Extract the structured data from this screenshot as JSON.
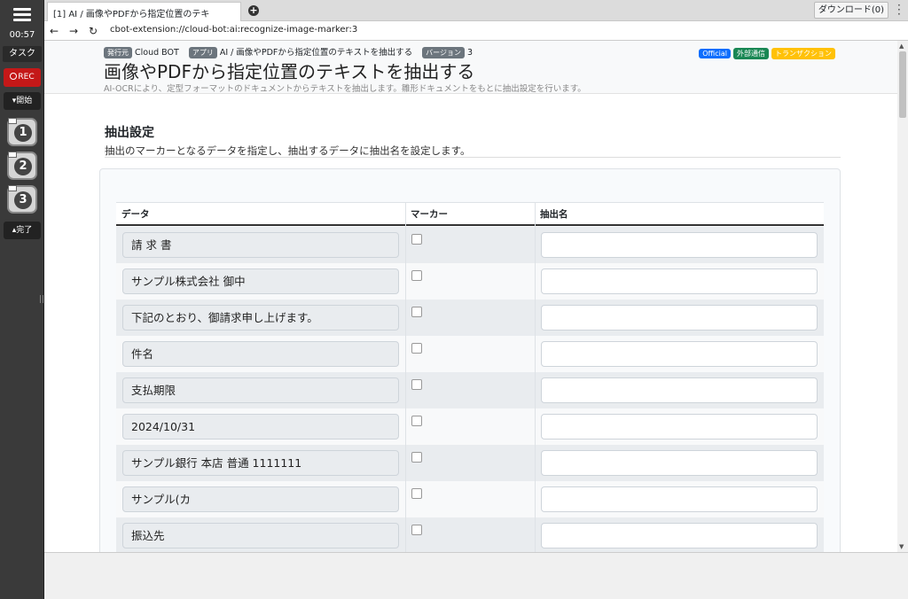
{
  "rail": {
    "timer": "00:57",
    "task_label": "タスク",
    "rec_label": "REC",
    "start_label": "開始",
    "steps": [
      "1",
      "2",
      "3"
    ],
    "done_label": "完了"
  },
  "browser": {
    "tab_title": "[1] AI / 画像やPDFから指定位置のテキ",
    "download_label": "ダウンロード(0)",
    "url": "cbot-extension://cloud-bot:ai:recognize-image-marker:3"
  },
  "header": {
    "publisher_label": "発行元",
    "publisher": "Cloud BOT",
    "app_label": "アプリ",
    "app": "AI / 画像やPDFから指定位置のテキストを抽出する",
    "version_label": "バージョン",
    "version": "3",
    "badges": [
      {
        "label": "Official",
        "color": "#0d6efd"
      },
      {
        "label": "外部通信",
        "color": "#198754"
      },
      {
        "label": "トランザクション",
        "color": "#ffc107"
      }
    ],
    "title": "画像やPDFから指定位置のテキストを抽出する",
    "subtitle": "AI-OCRにより、定型フォーマットのドキュメントからテキストを抽出します。雛形ドキュメントをもとに抽出設定を行います。"
  },
  "section": {
    "title": "抽出設定",
    "description": "抽出のマーカーとなるデータを指定し、抽出するデータに抽出名を設定します。"
  },
  "table": {
    "headers": {
      "data": "データ",
      "marker": "マーカー",
      "name": "抽出名"
    },
    "rows": [
      {
        "data": "請 求 書",
        "marker": false,
        "name": ""
      },
      {
        "data": "サンプル株式会社 御中",
        "marker": false,
        "name": ""
      },
      {
        "data": "下記のとおり、御請求申し上げます。",
        "marker": false,
        "name": ""
      },
      {
        "data": "件名",
        "marker": false,
        "name": ""
      },
      {
        "data": "支払期限",
        "marker": false,
        "name": ""
      },
      {
        "data": "2024/10/31",
        "marker": false,
        "name": ""
      },
      {
        "data": "サンプル銀行 本店 普通 1111111",
        "marker": false,
        "name": ""
      },
      {
        "data": "サンプル(カ",
        "marker": false,
        "name": ""
      },
      {
        "data": "振込先",
        "marker": false,
        "name": ""
      }
    ]
  }
}
